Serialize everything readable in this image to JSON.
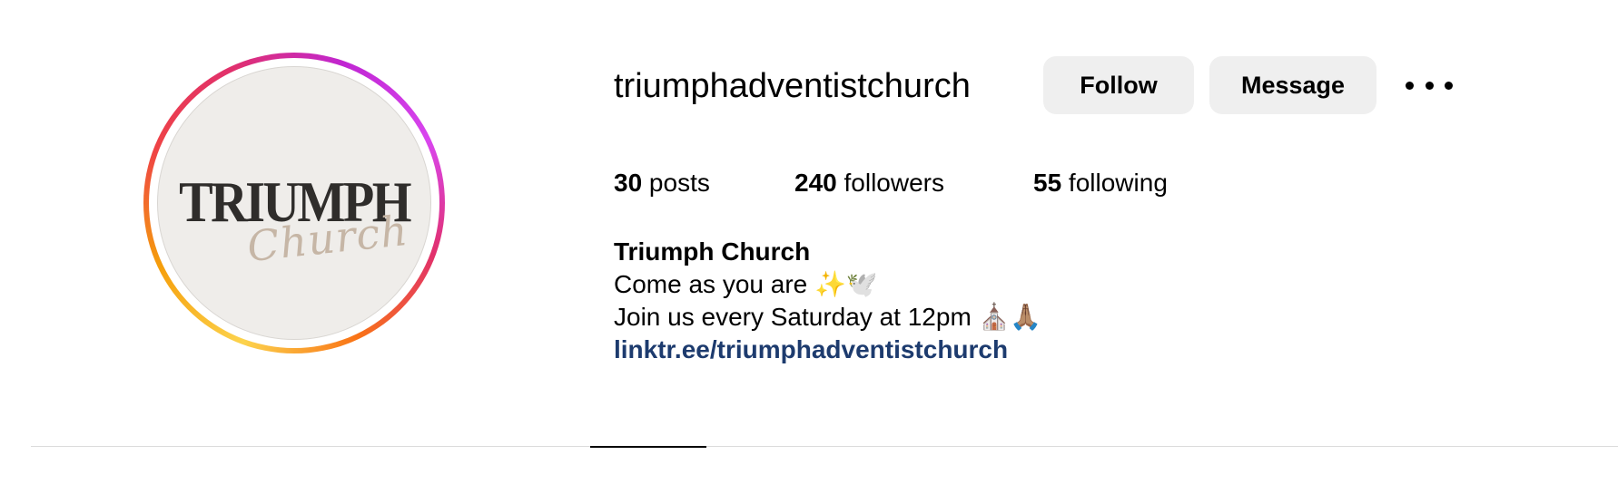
{
  "profile": {
    "avatar_logo_main": "TRIUMPH",
    "avatar_logo_script": "Church",
    "username": "triumphadventistchurch"
  },
  "actions": {
    "follow_label": "Follow",
    "message_label": "Message",
    "more_icon": "more-horizontal-icon"
  },
  "stats": {
    "posts_count": "30",
    "posts_label": " posts",
    "followers_count": "240",
    "followers_label": " followers",
    "following_count": "55",
    "following_label": " following"
  },
  "bio": {
    "display_name": "Triumph Church",
    "line1": "Come as you are ✨🕊️",
    "line2": "Join us every Saturday at 12pm ⛪🙏🏽",
    "link": "linktr.ee/triumphadventistchurch"
  },
  "colors": {
    "link": "#1d3b6e",
    "button_bg": "#efefef",
    "ring_start": "#fcd34d",
    "ring_end": "#c026d3"
  }
}
